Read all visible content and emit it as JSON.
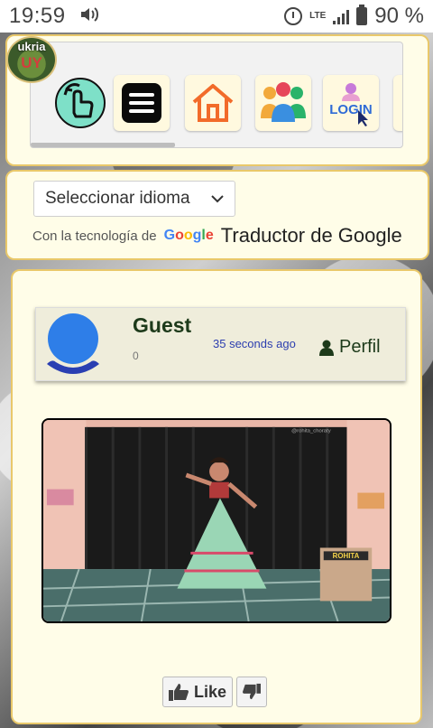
{
  "status_bar": {
    "time": "19:59",
    "network": "LTE",
    "battery_percent": "90 %",
    "icons": [
      "media-icon",
      "alarm-icon",
      "signal-icon",
      "battery-icon"
    ]
  },
  "logo": {
    "line1": "ukria",
    "line2": "UY"
  },
  "app_strip": {
    "items": [
      {
        "name": "touch-icon"
      },
      {
        "name": "menu-icon"
      },
      {
        "name": "home-icon"
      },
      {
        "name": "people-icon"
      },
      {
        "name": "login-icon",
        "label": "LOGIN"
      },
      {
        "name": "more-icon"
      }
    ]
  },
  "translate": {
    "select_value": "Seleccionar idioma",
    "powered_by": "Con la tecnología de",
    "google_logo": "Google",
    "link_text": "Traductor de Google"
  },
  "post": {
    "user_name": "Guest",
    "count": "0",
    "time_ago": "35 seconds ago",
    "profile_label": "Perfil",
    "video_watermark": "@rohita_choraty",
    "video_badge": "ROHITA"
  },
  "votes": {
    "like_label": "Like"
  },
  "colors": {
    "panel_bg": "#fffde8",
    "panel_border": "#e9c86a",
    "card_bg": "#efeddb",
    "name_color": "#1d3a1a",
    "time_color": "#2c3eaf"
  }
}
